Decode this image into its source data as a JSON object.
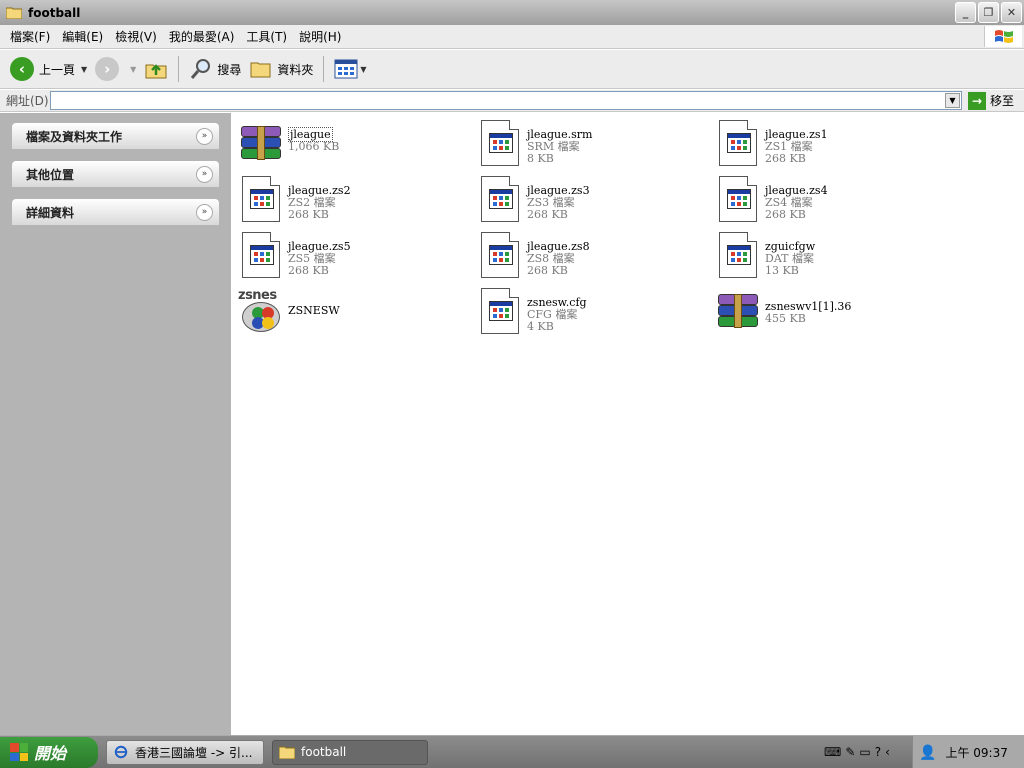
{
  "window": {
    "title": "football"
  },
  "menubar": {
    "items": [
      "檔案(F)",
      "編輯(E)",
      "檢視(V)",
      "我的最愛(A)",
      "工具(T)",
      "說明(H)"
    ]
  },
  "toolbar": {
    "back_label": "上一頁",
    "search_label": "搜尋",
    "folders_label": "資料夾"
  },
  "addressbar": {
    "label": "網址(D)",
    "value": "",
    "go_label": "移至"
  },
  "taskpane": {
    "panels": [
      "檔案及資料夾工作",
      "其他位置",
      "詳細資料"
    ]
  },
  "files": [
    {
      "name": "jleague",
      "type": "",
      "size": "1,066 KB",
      "icon": "winrar-archive-icon",
      "selected": true
    },
    {
      "name": "jleague.srm",
      "type": "SRM 檔案",
      "size": "8 KB",
      "icon": "generic-file-icon"
    },
    {
      "name": "jleague.zs1",
      "type": "ZS1 檔案",
      "size": "268 KB",
      "icon": "generic-file-icon"
    },
    {
      "name": "jleague.zs2",
      "type": "ZS2 檔案",
      "size": "268 KB",
      "icon": "generic-file-icon"
    },
    {
      "name": "jleague.zs3",
      "type": "ZS3 檔案",
      "size": "268 KB",
      "icon": "generic-file-icon"
    },
    {
      "name": "jleague.zs4",
      "type": "ZS4 檔案",
      "size": "268 KB",
      "icon": "generic-file-icon"
    },
    {
      "name": "jleague.zs5",
      "type": "ZS5 檔案",
      "size": "268 KB",
      "icon": "generic-file-icon"
    },
    {
      "name": "jleague.zs8",
      "type": "ZS8 檔案",
      "size": "268 KB",
      "icon": "generic-file-icon"
    },
    {
      "name": "zguicfgw",
      "type": "DAT 檔案",
      "size": "13 KB",
      "icon": "generic-file-icon"
    },
    {
      "name": "ZSNESW",
      "type": "",
      "size": "",
      "icon": "zsnes-app-icon"
    },
    {
      "name": "zsnesw.cfg",
      "type": "CFG 檔案",
      "size": "4 KB",
      "icon": "generic-file-icon"
    },
    {
      "name": "zsneswv1[1].36",
      "type": "",
      "size": "455 KB",
      "icon": "winrar-archive-icon"
    }
  ],
  "taskbar": {
    "start_label": "開始",
    "buttons": [
      {
        "label": "香港三國論壇 -> 引...",
        "icon": "ie-icon"
      },
      {
        "label": "football",
        "icon": "folder-icon"
      }
    ],
    "clock": "上午 09:37"
  }
}
